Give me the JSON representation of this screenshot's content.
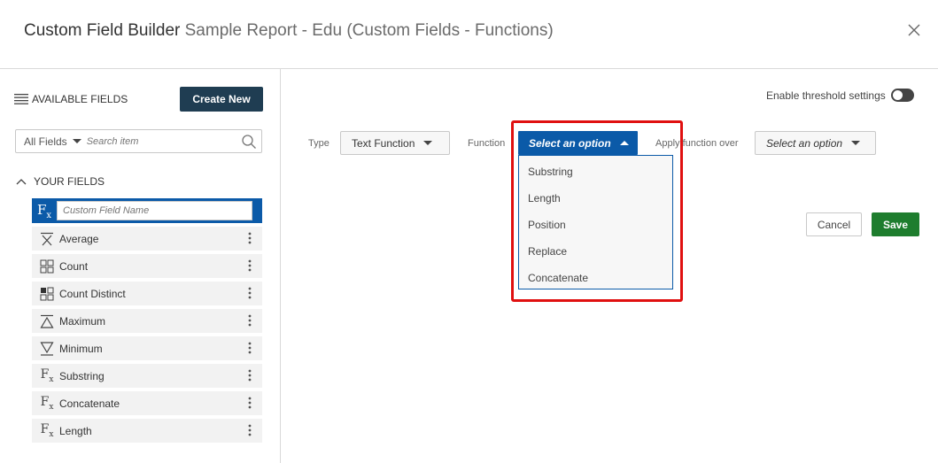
{
  "header": {
    "title": "Custom Field Builder",
    "subtitle": "Sample Report - Edu (Custom Fields - Functions)",
    "close_icon": "close-icon"
  },
  "sidebar": {
    "available_label": "AVAILABLE FIELDS",
    "create_new_label": "Create New",
    "filter_label": "All Fields",
    "search_placeholder": "Search item",
    "your_fields_label": "YOUR FIELDS",
    "custom_field_placeholder": "Custom Field Name",
    "fields": [
      {
        "label": "Average",
        "icon": "average-icon"
      },
      {
        "label": "Count",
        "icon": "count-icon"
      },
      {
        "label": "Count Distinct",
        "icon": "count-distinct-icon"
      },
      {
        "label": "Maximum",
        "icon": "maximum-icon"
      },
      {
        "label": "Minimum",
        "icon": "minimum-icon"
      },
      {
        "label": "Substring",
        "icon": "function-icon"
      },
      {
        "label": "Concatenate",
        "icon": "function-icon"
      },
      {
        "label": "Length",
        "icon": "function-icon"
      }
    ]
  },
  "main": {
    "threshold_label": "Enable threshold settings",
    "type_label": "Type",
    "type_value": "Text Function",
    "function_label": "Function",
    "function_value": "Select an option",
    "function_options": [
      "Substring",
      "Length",
      "Position",
      "Replace",
      "Concatenate"
    ],
    "apply_label": "Apply function over",
    "apply_value": "Select an option",
    "cancel_label": "Cancel",
    "save_label": "Save"
  },
  "colors": {
    "primary_blue": "#0b5aa8",
    "create_button": "#1f3d52",
    "save_green": "#1e7d2e",
    "highlight_red": "#e01010"
  }
}
